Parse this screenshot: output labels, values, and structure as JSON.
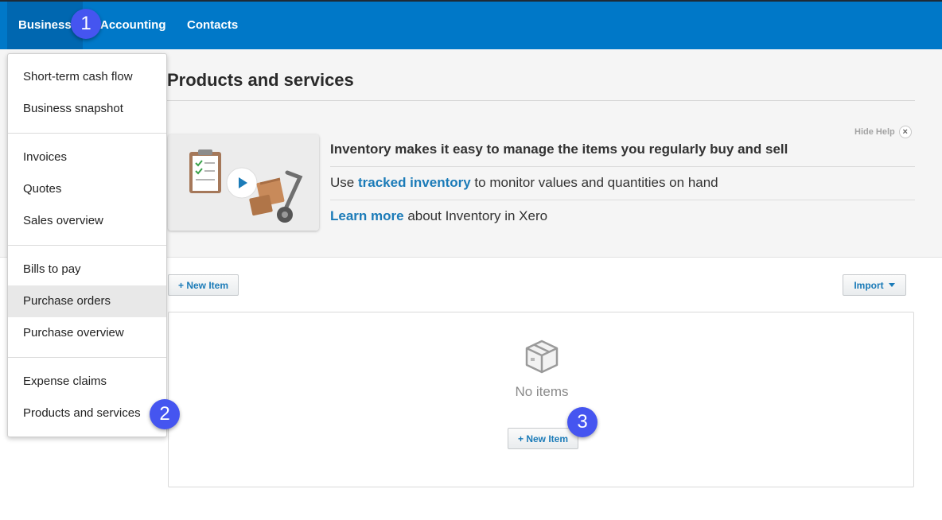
{
  "nav": {
    "business": "Business",
    "accounting": "Accounting",
    "contacts": "Contacts"
  },
  "page": {
    "title": "Products and services",
    "hide_help": "Hide Help",
    "hide_help_close": "×"
  },
  "help": {
    "headline": "Inventory makes it easy to manage the items you regularly buy and sell",
    "line2_prefix": "Use ",
    "line2_link": "tracked inventory",
    "line2_suffix": " to monitor values and quantities on hand",
    "line3_link": "Learn more",
    "line3_suffix": " about Inventory in Xero"
  },
  "toolbar": {
    "new_item": "+ New Item",
    "import": "Import"
  },
  "empty_state": {
    "message": "No items",
    "new_item": "+ New Item"
  },
  "menu": {
    "items": [
      "Short-term cash flow",
      "Business snapshot",
      "Invoices",
      "Quotes",
      "Sales overview",
      "Bills to pay",
      "Purchase orders",
      "Purchase overview",
      "Expense claims",
      "Products and services"
    ]
  },
  "callouts": [
    "1",
    "2",
    "3"
  ],
  "colors": {
    "topbar": "#0078c8",
    "link": "#1b7bb8",
    "callout": "#4555f0"
  }
}
